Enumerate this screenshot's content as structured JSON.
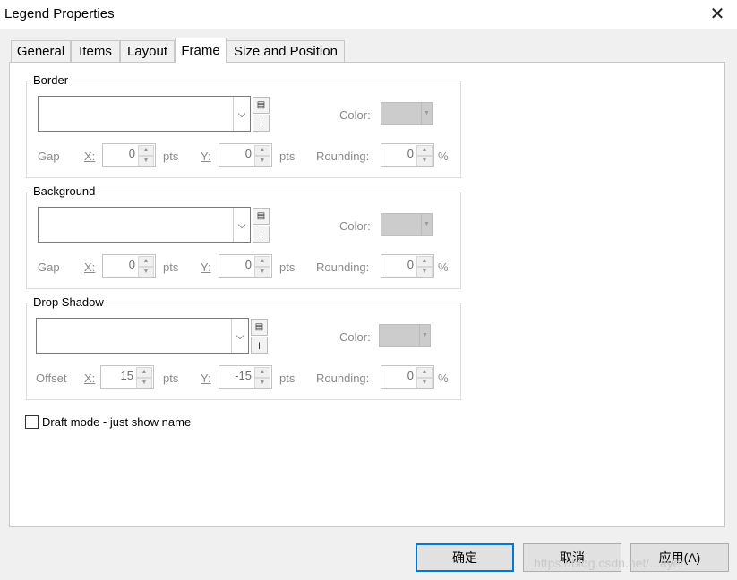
{
  "window": {
    "title": "Legend Properties"
  },
  "tabs": [
    {
      "label": "General"
    },
    {
      "label": "Items"
    },
    {
      "label": "Layout"
    },
    {
      "label": "Frame"
    },
    {
      "label": "Size and Position"
    }
  ],
  "border": {
    "label": "Border",
    "color_label": "Color:",
    "gap_label": "Gap",
    "x_label": "X:",
    "x_value": "0",
    "y_label": "Y:",
    "y_value": "0",
    "units": "pts",
    "rounding_label": "Rounding:",
    "rounding_value": "0",
    "percent": "%"
  },
  "background": {
    "label": "Background",
    "color_label": "Color:",
    "gap_label": "Gap",
    "x_label": "X:",
    "x_value": "0",
    "y_label": "Y:",
    "y_value": "0",
    "units": "pts",
    "rounding_label": "Rounding:",
    "rounding_value": "0",
    "percent": "%"
  },
  "shadow": {
    "label": "Drop Shadow",
    "color_label": "Color:",
    "offset_label": "Offset",
    "x_label": "X:",
    "x_value": "15",
    "y_label": "Y:",
    "y_value": "-15",
    "units": "pts",
    "rounding_label": "Rounding:",
    "rounding_value": "0",
    "percent": "%"
  },
  "draft_mode": {
    "label": "Draft mode - just show name",
    "checked": false
  },
  "buttons": {
    "ok": "确定",
    "cancel": "取消",
    "apply": "应用(A)"
  },
  "watermark": "https://blog.csdn.net/...ayer",
  "icons": {
    "close": "close-icon",
    "dropdown": "chevron-down-icon",
    "symbol": "symbol-selector-icon",
    "properties": "properties-icon"
  }
}
